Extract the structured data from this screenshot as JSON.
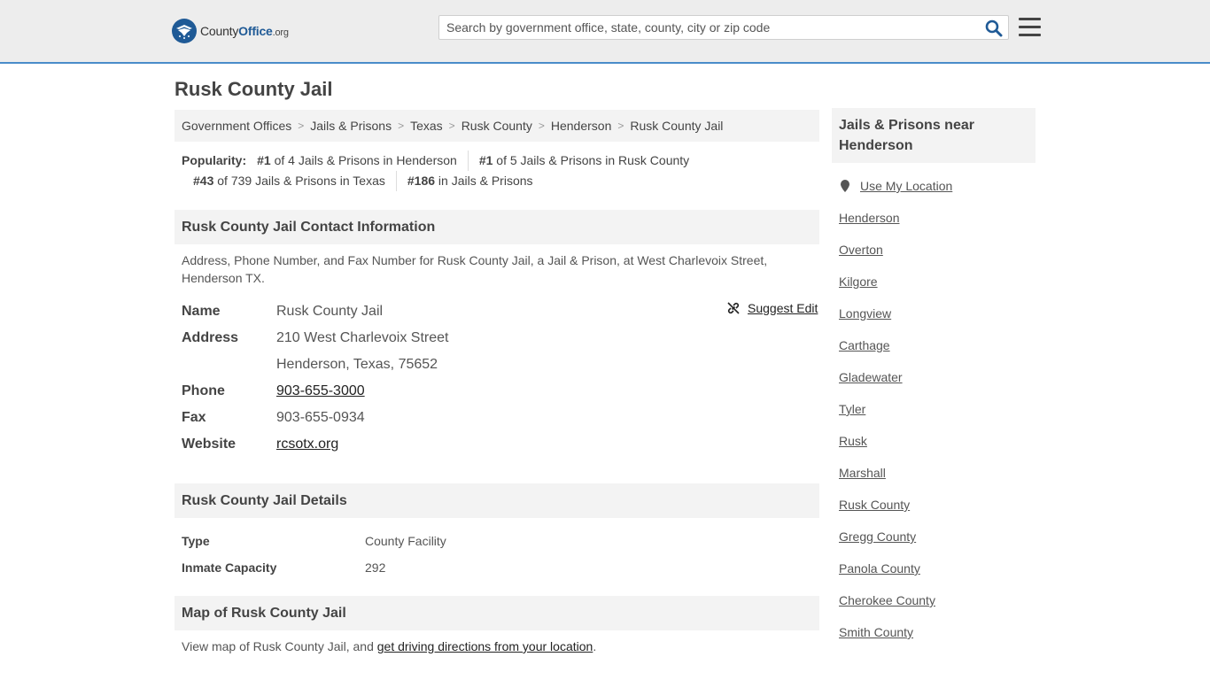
{
  "header": {
    "logo": {
      "name_a": "County",
      "name_b": "Office",
      "name_c": ".org"
    },
    "search_placeholder": "Search by government office, state, county, city or zip code"
  },
  "page_title": "Rusk County Jail",
  "breadcrumb": [
    "Government Offices",
    "Jails & Prisons",
    "Texas",
    "Rusk County",
    "Henderson",
    "Rusk County Jail"
  ],
  "popularity": {
    "label": "Popularity:",
    "items": [
      {
        "rank": "#1",
        "text": "of 4 Jails & Prisons in Henderson"
      },
      {
        "rank": "#1",
        "text": "of 5 Jails & Prisons in Rusk County"
      },
      {
        "rank": "#43",
        "text": "of 739 Jails & Prisons in Texas"
      },
      {
        "rank": "#186",
        "text": "in Jails & Prisons"
      }
    ]
  },
  "contact": {
    "heading": "Rusk County Jail Contact Information",
    "description": "Address, Phone Number, and Fax Number for Rusk County Jail, a Jail & Prison, at West Charlevoix Street, Henderson TX.",
    "suggest_edit": "Suggest Edit",
    "rows": {
      "name": {
        "label": "Name",
        "value": "Rusk County Jail"
      },
      "address": {
        "label": "Address",
        "line1": "210 West Charlevoix Street",
        "line2": "Henderson, Texas, 75652"
      },
      "phone": {
        "label": "Phone",
        "value": "903-655-3000"
      },
      "fax": {
        "label": "Fax",
        "value": "903-655-0934"
      },
      "website": {
        "label": "Website",
        "value": "rcsotx.org"
      }
    }
  },
  "details": {
    "heading": "Rusk County Jail Details",
    "rows": [
      {
        "label": "Type",
        "value": "County Facility"
      },
      {
        "label": "Inmate Capacity",
        "value": "292"
      }
    ]
  },
  "map": {
    "heading": "Map of Rusk County Jail",
    "text": "View map of Rusk County Jail, and ",
    "link": "get driving directions from your location",
    "end": "."
  },
  "sidebar": {
    "heading": "Jails & Prisons near Henderson",
    "use_location": "Use My Location",
    "places": [
      "Henderson",
      "Overton",
      "Kilgore",
      "Longview",
      "Carthage",
      "Gladewater",
      "Tyler",
      "Rusk",
      "Marshall",
      "Rusk County",
      "Gregg County",
      "Panola County",
      "Cherokee County",
      "Smith County"
    ]
  },
  "colors": {
    "brand": "#1f5a96",
    "header_bg": "#ededed",
    "header_border": "#4a8cc9",
    "panel_bg": "#f3f3f3"
  }
}
